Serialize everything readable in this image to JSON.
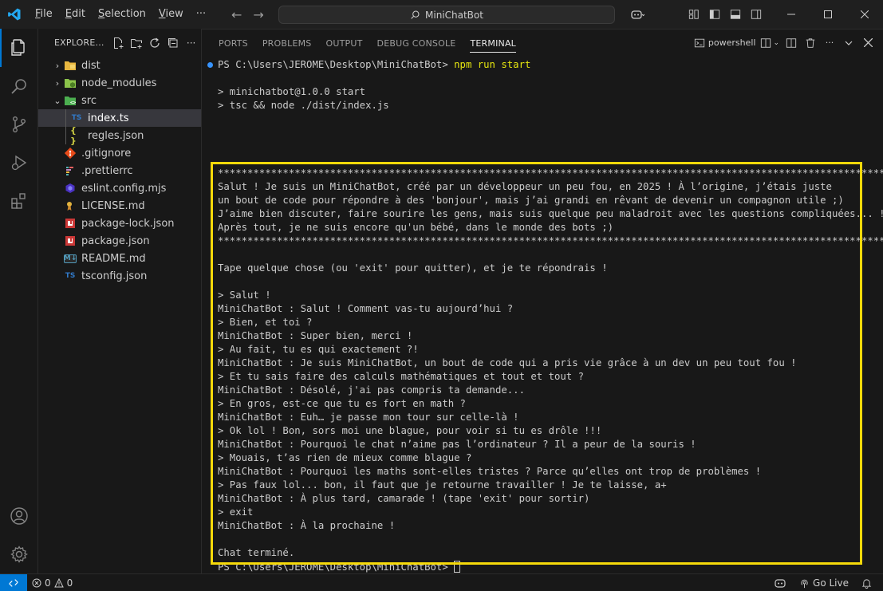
{
  "menu": {
    "file": "File",
    "edit": "Edit",
    "selection": "Selection",
    "view": "View",
    "more": "···"
  },
  "command_center": {
    "label": "MiniChatBot"
  },
  "explorer": {
    "title": "EXPLORE...",
    "items": [
      {
        "label": "dist",
        "type": "folder",
        "expanded": false
      },
      {
        "label": "node_modules",
        "type": "folder",
        "expanded": false
      },
      {
        "label": "src",
        "type": "folder-src",
        "expanded": true
      },
      {
        "label": "index.ts",
        "type": "ts",
        "selected": true,
        "icon_text": "TS"
      },
      {
        "label": "regles.json",
        "type": "json",
        "icon_text": "{ }"
      },
      {
        "label": ".gitignore",
        "type": "git"
      },
      {
        "label": ".prettierrc",
        "type": "prettier"
      },
      {
        "label": "eslint.config.mjs",
        "type": "eslint"
      },
      {
        "label": "LICENSE.md",
        "type": "license"
      },
      {
        "label": "package-lock.json",
        "type": "npm"
      },
      {
        "label": "package.json",
        "type": "npm"
      },
      {
        "label": "README.md",
        "type": "md",
        "icon_text": "M↓"
      },
      {
        "label": "tsconfig.json",
        "type": "tsconfig",
        "icon_text": "TS"
      }
    ]
  },
  "panel": {
    "tabs": [
      "PORTS",
      "PROBLEMS",
      "OUTPUT",
      "DEBUG CONSOLE",
      "TERMINAL"
    ],
    "active_tab": "TERMINAL",
    "shell_label": "powershell"
  },
  "terminal": {
    "prompt": "PS C:\\Users\\JEROME\\Desktop\\MiniChatBot>",
    "command": "npm run start",
    "script_line1": "> minichatbot@1.0.0 start",
    "script_line2": "> tsc && node ./dist/index.js",
    "stars": "*****************************************************************************************************************",
    "intro": [
      "Salut ! Je suis un MiniChatBot, créé par un développeur un peu fou, en 2025 ! À l’origine, j’étais juste",
      "un bout de code pour répondre à des 'bonjour', mais j’ai grandi en rêvant de devenir un compagnon utile ;)",
      "J’aime bien discuter, faire sourire les gens, mais suis quelque peu maladroit avec les questions compliquées... !",
      "Après tout, je ne suis encore qu'un bébé, dans le monde des bots ;)"
    ],
    "instructions": "Tape quelque chose (ou 'exit' pour quitter), et je te répondrais !",
    "conversation": [
      "> Salut !",
      "MiniChatBot : Salut ! Comment vas-tu aujourd’hui ?",
      "> Bien, et toi ?",
      "MiniChatBot : Super bien, merci !",
      "> Au fait, tu es qui exactement ?!",
      "MiniChatBot : Je suis MiniChatBot, un bout de code qui a pris vie grâce à un dev un peu tout fou !",
      "> Et tu sais faire des calculs mathématiques et tout et tout ?",
      "MiniChatBot : Désolé, j'ai pas compris ta demande...",
      "> En gros, est-ce que tu es fort en math ?",
      "MiniChatBot : Euh… je passe mon tour sur celle-là !",
      "> Ok lol ! Bon, sors moi une blague, pour voir si tu es drôle !!!",
      "MiniChatBot : Pourquoi le chat n’aime pas l’ordinateur ? Il a peur de la souris !",
      "> Mouais, t’as rien de mieux comme blague ?",
      "MiniChatBot : Pourquoi les maths sont-elles tristes ? Parce qu’elles ont trop de problèmes !",
      "> Pas faux lol... bon, il faut que je retourne travailler ! Je te laisse, a+",
      "MiniChatBot : À plus tard, camarade ! (tape 'exit' pour sortir)",
      "> exit",
      "MiniChatBot : À la prochaine !"
    ],
    "ended": "Chat terminé.",
    "final_prompt": "PS C:\\Users\\JEROME\\Desktop\\MiniChatBot>"
  },
  "statusbar": {
    "errors": "0",
    "warnings": "0",
    "go_live": "Go Live"
  },
  "colors": {
    "accent": "#0078d4",
    "highlight_border": "#f5d90a"
  }
}
